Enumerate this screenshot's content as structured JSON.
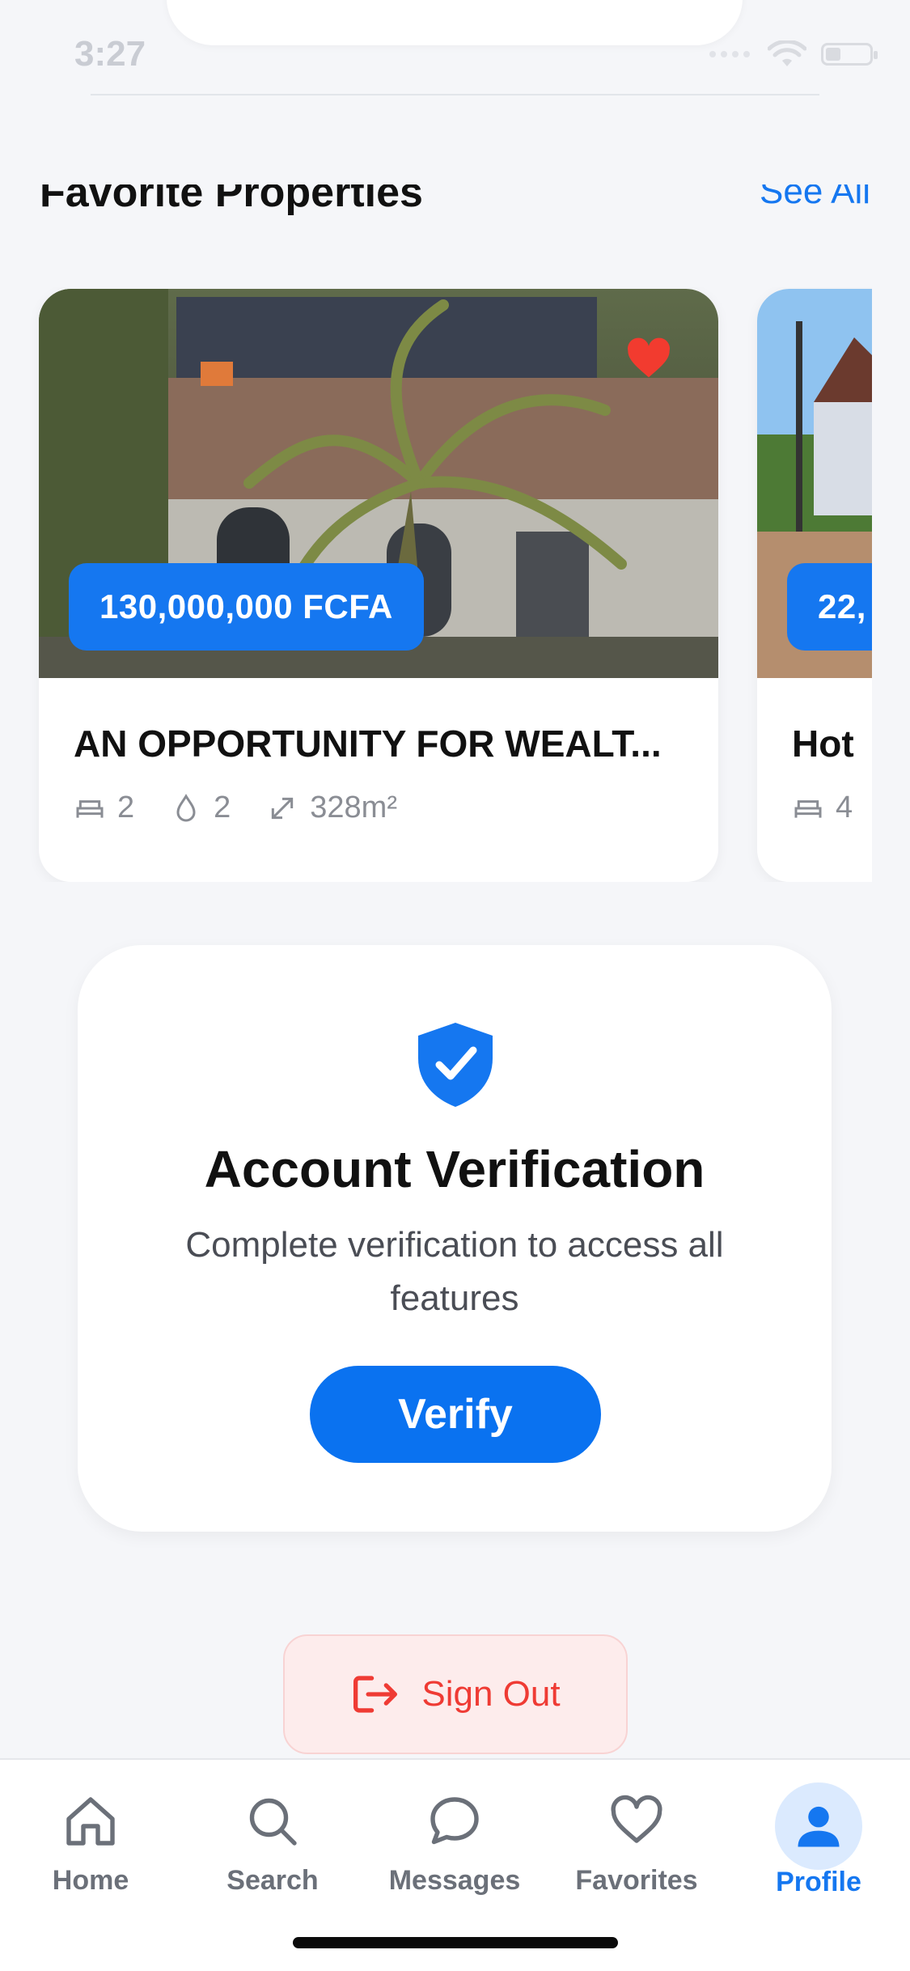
{
  "status_bar": {
    "time": "3:27"
  },
  "section": {
    "title": "Favorite Properties",
    "see_all": "See All"
  },
  "properties": [
    {
      "price": "130,000,000 FCFA",
      "title": "AN OPPORTUNITY FOR WEALT...",
      "bedrooms": "2",
      "bathrooms": "2",
      "area": "328m²",
      "favorited": true
    },
    {
      "price": "22,",
      "title": "Hot",
      "bedrooms": "4"
    }
  ],
  "verification": {
    "title": "Account Verification",
    "subtitle": "Complete verification to access all features",
    "button": "Verify"
  },
  "sign_out": {
    "label": "Sign Out"
  },
  "tabbar": {
    "items": [
      {
        "label": "Home",
        "icon": "home-icon"
      },
      {
        "label": "Search",
        "icon": "search-icon"
      },
      {
        "label": "Messages",
        "icon": "chat-bubble-icon"
      },
      {
        "label": "Favorites",
        "icon": "heart-icon"
      },
      {
        "label": "Profile",
        "icon": "user-icon",
        "active": true
      }
    ]
  },
  "colors": {
    "accent": "#1577f0",
    "danger": "#ef3b34",
    "background": "#f5f6f9"
  }
}
